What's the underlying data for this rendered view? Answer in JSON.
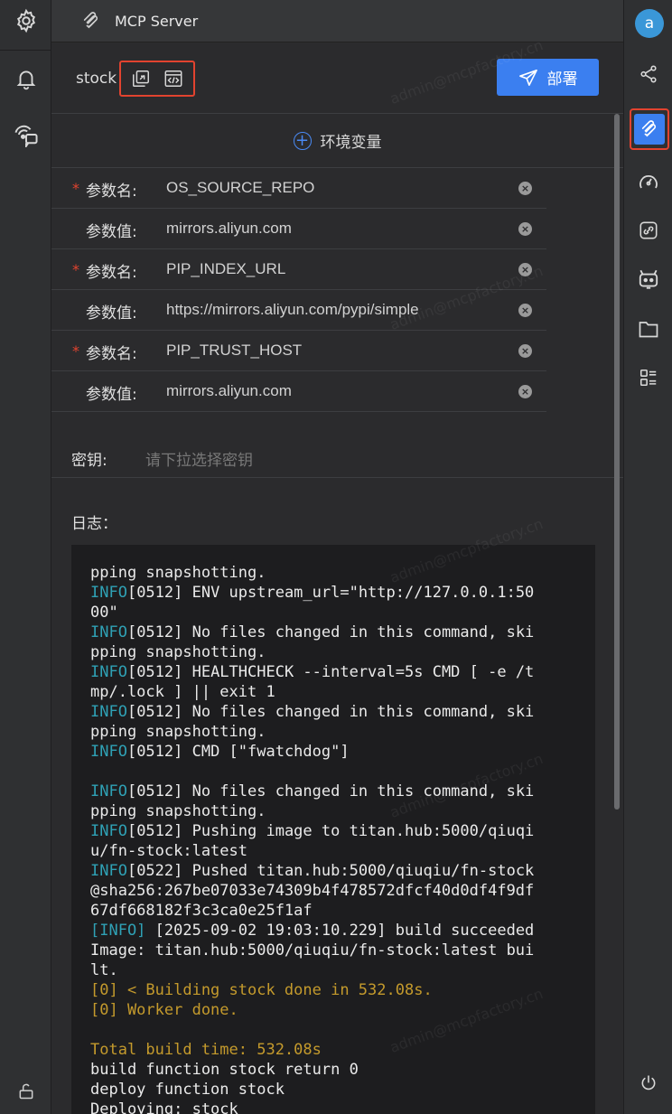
{
  "header": {
    "title": "MCP Server"
  },
  "left_rail": {
    "icons": [
      "gear-icon",
      "bell-icon",
      "chat-broadcast-icon",
      "unlock-icon"
    ]
  },
  "right_rail": {
    "avatar_letter": "a",
    "icons": [
      "share-icon",
      "mcp-icon",
      "gauge-icon",
      "link-icon",
      "robot-icon",
      "folder-icon",
      "list-icon",
      "power-icon"
    ],
    "active": "mcp-icon"
  },
  "server": {
    "name": "stock",
    "deploy_label": "部署"
  },
  "env": {
    "add_label": "环境变量",
    "params": [
      {
        "label": "参数名:",
        "required": true,
        "value": "OS_SOURCE_REPO"
      },
      {
        "label": "参数值:",
        "required": false,
        "value": "mirrors.aliyun.com"
      },
      {
        "label": "参数名:",
        "required": true,
        "value": "PIP_INDEX_URL"
      },
      {
        "label": "参数值:",
        "required": false,
        "value": "https://mirrors.aliyun.com/pypi/simple"
      },
      {
        "label": "参数名:",
        "required": true,
        "value": "PIP_TRUST_HOST"
      },
      {
        "label": "参数值:",
        "required": false,
        "value": "mirrors.aliyun.com"
      }
    ]
  },
  "secret": {
    "label": "密钥:",
    "placeholder": "请下拉选择密钥"
  },
  "log": {
    "label": "日志：",
    "lines": [
      [
        {
          "t": "pping snapshotting."
        }
      ],
      [
        {
          "t": "INFO",
          "c": "info"
        },
        {
          "t": "[0512] ENV upstream_url=\"http://127.0.0.1:50"
        }
      ],
      [
        {
          "t": "00\""
        }
      ],
      [
        {
          "t": "INFO",
          "c": "info"
        },
        {
          "t": "[0512] No files changed in this command, ski"
        }
      ],
      [
        {
          "t": "pping snapshotting."
        }
      ],
      [
        {
          "t": "INFO",
          "c": "info"
        },
        {
          "t": "[0512] HEALTHCHECK --interval=5s CMD [ -e /t"
        }
      ],
      [
        {
          "t": "mp/.lock ] || exit 1"
        }
      ],
      [
        {
          "t": "INFO",
          "c": "info"
        },
        {
          "t": "[0512] No files changed in this command, ski"
        }
      ],
      [
        {
          "t": "pping snapshotting."
        }
      ],
      [
        {
          "t": "INFO",
          "c": "info"
        },
        {
          "t": "[0512] CMD [\"fwatchdog\"]"
        }
      ],
      [
        {
          "t": ""
        }
      ],
      [
        {
          "t": "INFO",
          "c": "info"
        },
        {
          "t": "[0512] No files changed in this command, ski"
        }
      ],
      [
        {
          "t": "pping snapshotting."
        }
      ],
      [
        {
          "t": "INFO",
          "c": "info"
        },
        {
          "t": "[0512] Pushing image to titan.hub:5000/qiuqi"
        }
      ],
      [
        {
          "t": "u/fn-stock:latest"
        }
      ],
      [
        {
          "t": "INFO",
          "c": "info"
        },
        {
          "t": "[0522] Pushed titan.hub:5000/qiuqiu/fn-stock"
        }
      ],
      [
        {
          "t": "@sha256:267be07033e74309b4f478572dfcf40d0df4f9df"
        }
      ],
      [
        {
          "t": "67df668182f3c3ca0e25f1af"
        }
      ],
      [
        {
          "t": "[INFO]",
          "c": "info"
        },
        {
          "t": " [2025-09-02 19:03:10.229] build succeeded"
        }
      ],
      [
        {
          "t": "Image: titan.hub:5000/qiuqiu/fn-stock:latest bui"
        }
      ],
      [
        {
          "t": "lt."
        }
      ],
      [
        {
          "t": "[0] < Building stock done in 532.08s.",
          "c": "yel"
        }
      ],
      [
        {
          "t": "[0] Worker done.",
          "c": "yel"
        }
      ],
      [
        {
          "t": ""
        }
      ],
      [
        {
          "t": "Total build time: 532.08s",
          "c": "yel"
        }
      ],
      [
        {
          "t": "build function stock return 0"
        }
      ],
      [
        {
          "t": "deploy function stock"
        }
      ],
      [
        {
          "t": "Deploying: stock"
        }
      ]
    ]
  },
  "watermark": "admin@mcpfactory.cn"
}
